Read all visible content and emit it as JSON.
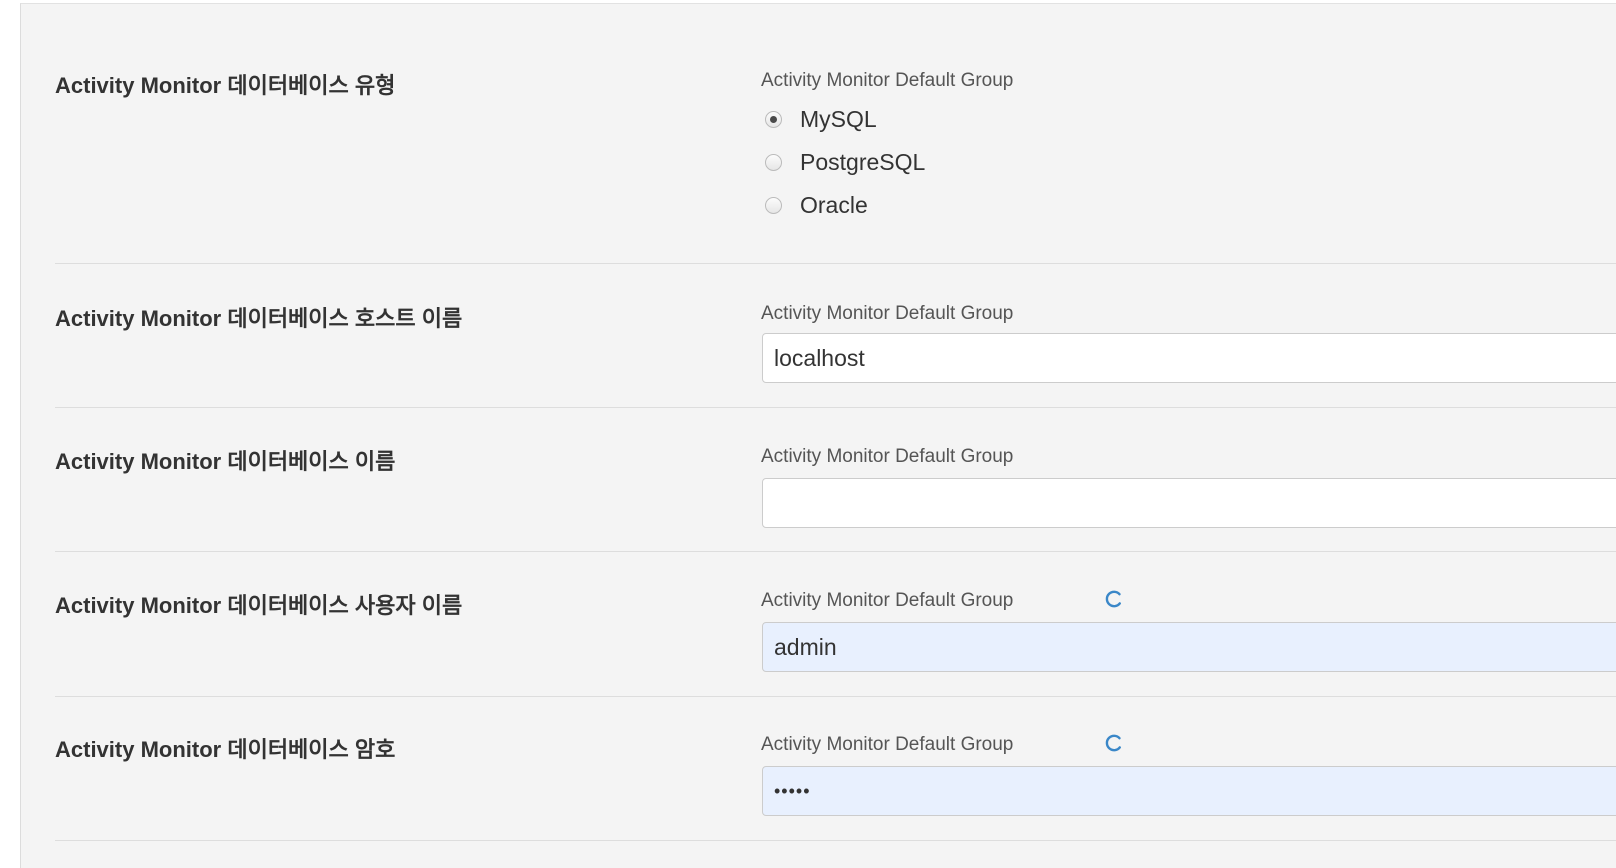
{
  "rows": [
    {
      "label": "Activity Monitor 데이터베이스 유형",
      "group": "Activity Monitor Default Group",
      "options": [
        "MySQL",
        "PostgreSQL",
        "Oracle"
      ],
      "selected": "MySQL"
    },
    {
      "label": "Activity Monitor 데이터베이스 호스트 이름",
      "group": "Activity Monitor Default Group",
      "value": "localhost"
    },
    {
      "label": "Activity Monitor 데이터베이스 이름",
      "group": "Activity Monitor Default Group",
      "value": ""
    },
    {
      "label": "Activity Monitor 데이터베이스 사용자 이름",
      "group": "Activity Monitor Default Group",
      "value": "admin",
      "reset_icon": "refresh-icon"
    },
    {
      "label": "Activity Monitor 데이터베이스 암호",
      "group": "Activity Monitor Default Group",
      "value": "•••••",
      "reset_icon": "refresh-icon"
    }
  ],
  "colors": {
    "panel_bg": "#f4f4f4",
    "autofill_bg": "#e8f0fe",
    "accent": "#3a87c8"
  }
}
